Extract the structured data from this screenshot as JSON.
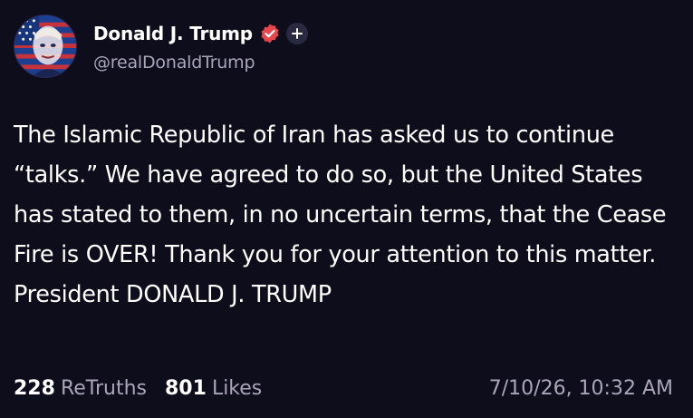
{
  "author": {
    "display_name": "Donald J. Trump",
    "handle": "@realDonaldTrump",
    "avatar_icon": "avatar-flag-portrait",
    "verified_icon": "verified-badge-icon",
    "follow_icon": "plus-icon"
  },
  "post": {
    "text": "The Islamic Republic of Iran has asked us to continue “talks.” We have agreed to do so, but the United States has stated to them, in no uncertain terms, that the Cease Fire is OVER! Thank you for your attention to this matter. President DONALD J. TRUMP"
  },
  "stats": {
    "retruths_count": "228",
    "retruths_label": "ReTruths",
    "likes_count": "801",
    "likes_label": "Likes"
  },
  "timestamp": "7/10/26, 10:32 AM",
  "colors": {
    "background": "#0e0d1c",
    "text": "#ffffff",
    "muted": "#a8a6b8",
    "verified": "#e8464d"
  }
}
